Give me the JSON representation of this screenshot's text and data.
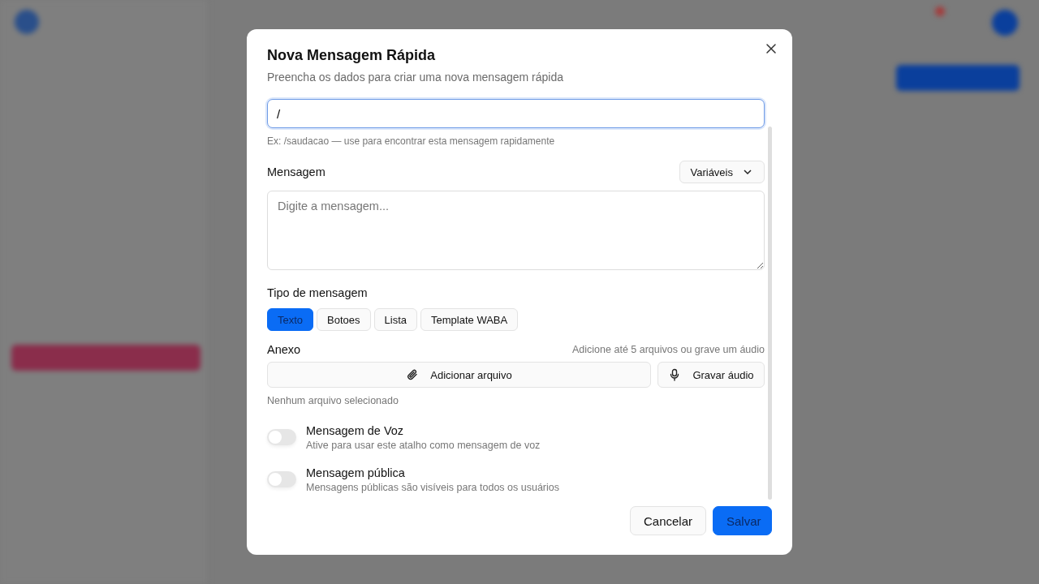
{
  "dialog": {
    "title": "Nova Mensagem Rápida",
    "subtitle": "Preencha os dados para criar uma nova mensagem rápida",
    "shortcut": {
      "value": "/",
      "hint": "Ex: /saudacao — use para encontrar esta mensagem rapidamente"
    },
    "message": {
      "label": "Mensagem",
      "variables_button": "Variáveis",
      "placeholder": "Digite a mensagem..."
    },
    "type": {
      "label": "Tipo de mensagem",
      "options": [
        {
          "label": "Texto",
          "selected": true
        },
        {
          "label": "Botoes",
          "selected": false
        },
        {
          "label": "Lista",
          "selected": false
        },
        {
          "label": "Template WABA",
          "selected": false
        }
      ]
    },
    "attachment": {
      "label": "Anexo",
      "note": "Adicione até 5 arquivos ou grave um áudio",
      "add_button": "Adicionar arquivo",
      "record_button": "Gravar áudio",
      "status": "Nenhum arquivo selecionado"
    },
    "toggles": [
      {
        "title": "Mensagem de Voz",
        "description": "Ative para usar este atalho como mensagem de voz",
        "on": false
      },
      {
        "title": "Mensagem pública",
        "description": "Mensagens públicas são visíveis para todos os usuários",
        "on": false
      }
    ],
    "buttons": [
      {
        "label": "Cancelar",
        "kind": "secondary"
      },
      {
        "label": "Salvar",
        "kind": "primary"
      }
    ]
  }
}
